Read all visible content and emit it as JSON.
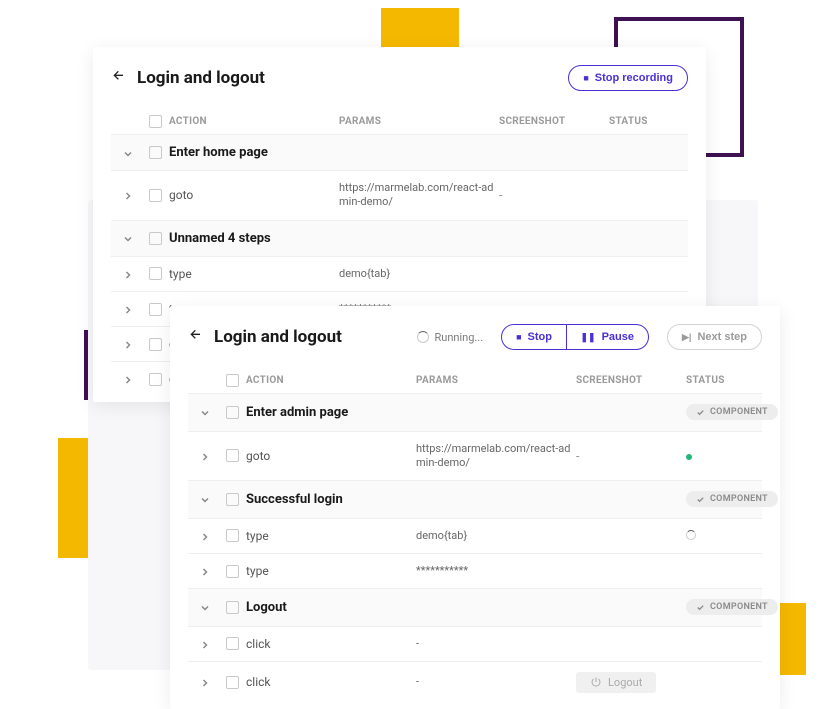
{
  "decor": {
    "yellow": "#f5b800",
    "purple": "#3d1152"
  },
  "columns": {
    "action": "ACTION",
    "params": "PARAMS",
    "screenshot": "SCREENSHOT",
    "status": "STATUS"
  },
  "panel1": {
    "title": "Login and logout",
    "stop_recording_label": "Stop recording",
    "groups": [
      {
        "name": "Enter home page",
        "rows": [
          {
            "action": "goto",
            "params": "https://marmelab.com/react-admin-demo/",
            "screenshot": "dash"
          }
        ]
      },
      {
        "name": "Unnamed 4 steps",
        "rows": [
          {
            "action": "type",
            "params": "demo{tab}",
            "screenshot": "placeholder"
          },
          {
            "action": "type",
            "params": "***********",
            "screenshot": "cursor"
          },
          {
            "action": "click",
            "params": "-",
            "screenshot": "avatar"
          },
          {
            "action": "cli",
            "params": "",
            "screenshot": ""
          }
        ]
      }
    ]
  },
  "panel2": {
    "title": "Login and logout",
    "running_label": "Running...",
    "stop_label": "Stop",
    "pause_label": "Pause",
    "next_label": "Next step",
    "component_badge": "COMPONENT",
    "logout_label": "Logout",
    "groups": [
      {
        "name": "Enter admin page",
        "rows": [
          {
            "action": "goto",
            "params": "https://marmelab.com/react-admin-demo/",
            "screenshot": "dash",
            "status": "pass"
          }
        ]
      },
      {
        "name": "Successful login",
        "rows": [
          {
            "action": "type",
            "params": "demo{tab}",
            "screenshot": "placeholder",
            "status": "running"
          },
          {
            "action": "type",
            "params": "***********",
            "screenshot": "cursor",
            "status": ""
          }
        ]
      },
      {
        "name": "Logout",
        "rows": [
          {
            "action": "click",
            "params": "-",
            "screenshot": "avatar",
            "status": ""
          },
          {
            "action": "click",
            "params": "-",
            "screenshot": "logout",
            "status": ""
          }
        ]
      }
    ]
  }
}
